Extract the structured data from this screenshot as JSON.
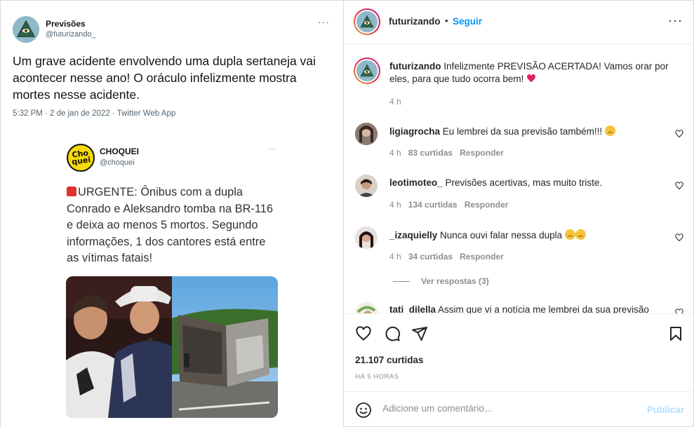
{
  "tweet": {
    "name": "Previsões",
    "handle": "@futurizando_",
    "more": "···",
    "text": "Um grave acidente envolvendo uma dupla sertaneja vai acontecer nesse ano! O oráculo infelizmente mostra mortes nesse acidente.",
    "meta": "5:32 PM · 2 de jan de 2022 · Twitter Web App",
    "avatar_icon": "illuminati-eye-icon"
  },
  "quoted": {
    "logo_text": "Cho quei",
    "name": "CHOQUEI",
    "handle": "@choquei",
    "more": "···",
    "text": "URGENTE: Ônibus com a dupla Conrado e Aleksandro tomba na BR-116 e deixa ao menos 5 mortos. Segundo informações, 1 dos cantores está entre as vítimas fatais!",
    "siren_icon": "siren-emoji-icon"
  },
  "instagram": {
    "header": {
      "username": "futurizando",
      "dot": "•",
      "follow": "Seguir",
      "more": "···"
    },
    "caption": {
      "username": "futurizando",
      "text": "Infelizmente PREVISÃO ACERTADA! Vamos orar por eles, para que tudo ocorra bem!",
      "time": "4 h"
    },
    "comments": [
      {
        "username": "ligiagrocha",
        "text": "Eu lembrei da sua previsão também!!!",
        "time": "4 h",
        "likes": "83 curtidas",
        "reply": "Responder"
      },
      {
        "username": "leotimoteo_",
        "text": "Previsões acertivas, mas muito triste.",
        "time": "4 h",
        "likes": "134 curtidas",
        "reply": "Responder"
      },
      {
        "username": "_izaquielly",
        "text": "Nunca ouvi falar nessa dupla",
        "time": "4 h",
        "likes": "34 curtidas",
        "reply": "Responder"
      },
      {
        "username": "tati_dilella",
        "text": "Assim que vi a notícia me lembrei da sua previsão"
      }
    ],
    "view_replies": "Ver respostas (3)",
    "likes": "21.107 curtidas",
    "ago": "HÁ 5 HORAS",
    "comment_placeholder": "Adicione um comentário...",
    "publish": "Publicar"
  },
  "colors": {
    "follow_blue": "#0095f6",
    "publish_disabled": "#b2dffc",
    "heart_red": "#ed4956"
  }
}
